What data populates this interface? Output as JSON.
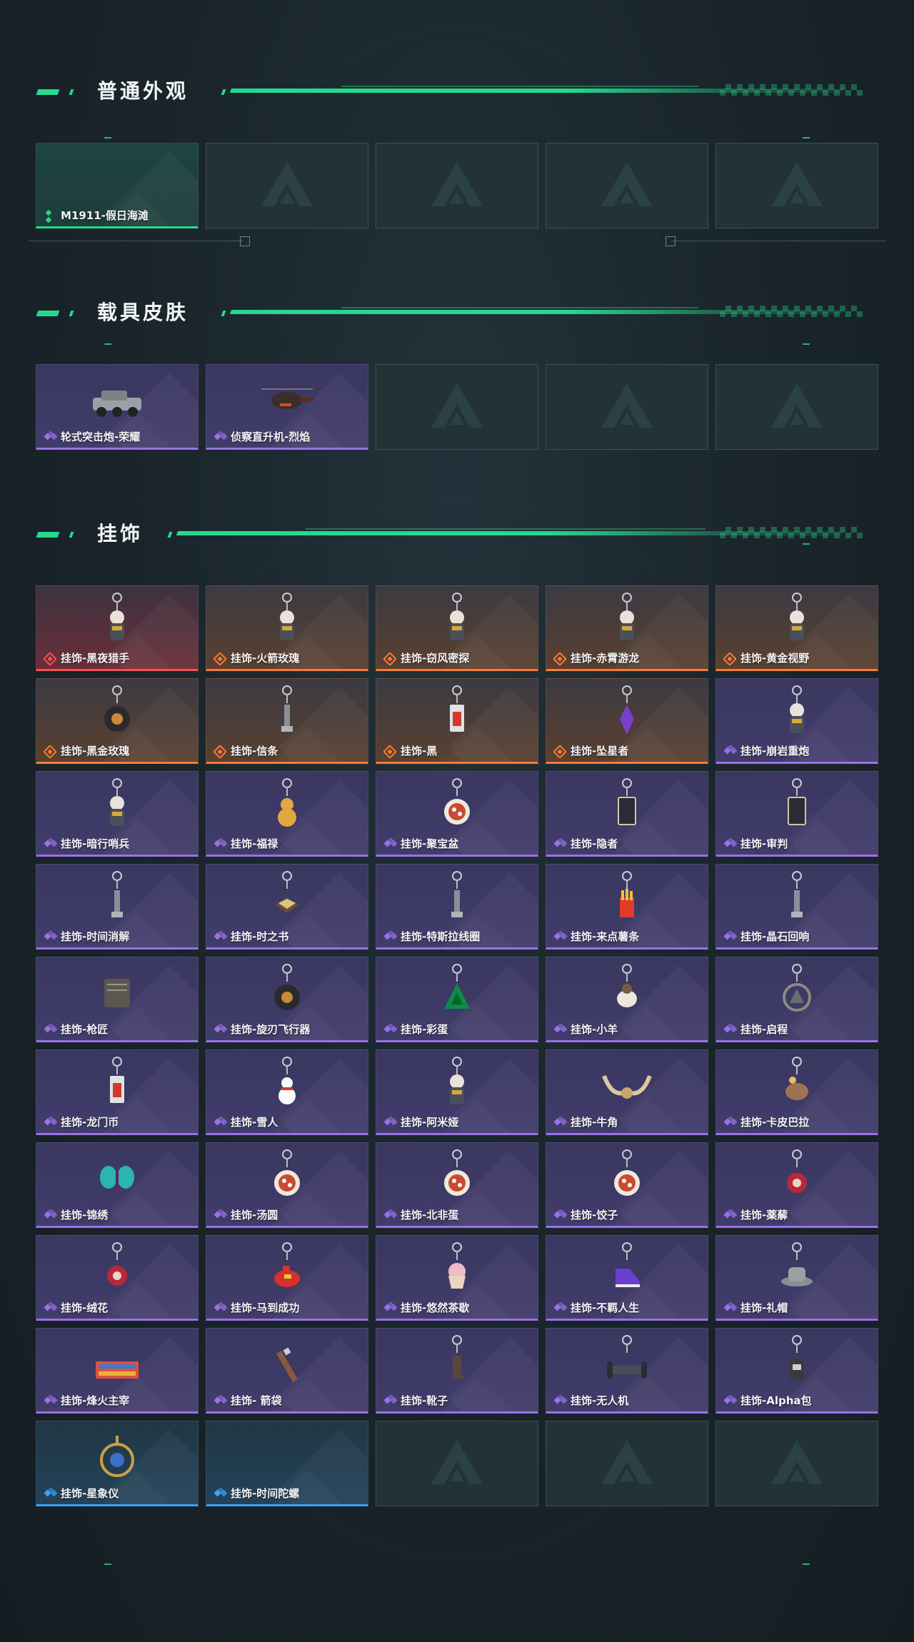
{
  "colors": {
    "accent": "#27d98d",
    "rarity_green": "#27d98d",
    "rarity_purple": "#9b71e8",
    "rarity_orange": "#ff7a33",
    "rarity_red": "#ff4d55",
    "rarity_blue": "#3aa3f5"
  },
  "sections": {
    "appearance": {
      "title": "普通外观",
      "items": [
        {
          "label": "M1911-假日海滩",
          "rarity": "green",
          "icon": "pistol-icon"
        },
        {
          "label": "",
          "rarity": "empty"
        },
        {
          "label": "",
          "rarity": "empty"
        },
        {
          "label": "",
          "rarity": "empty"
        },
        {
          "label": "",
          "rarity": "empty"
        }
      ]
    },
    "vehicle": {
      "title": "载具皮肤",
      "items": [
        {
          "label": "轮式突击炮-荣耀",
          "rarity": "purple",
          "icon": "armored-vehicle-icon"
        },
        {
          "label": "侦察直升机-烈焰",
          "rarity": "purple",
          "icon": "helicopter-icon"
        },
        {
          "label": "",
          "rarity": "empty"
        },
        {
          "label": "",
          "rarity": "empty"
        },
        {
          "label": "",
          "rarity": "empty"
        }
      ]
    },
    "charms": {
      "title": "挂饰",
      "items": [
        {
          "label": "挂饰-黑夜猎手",
          "rarity": "red",
          "icon": "figure-charm-icon"
        },
        {
          "label": "挂饰-火箭玫瑰",
          "rarity": "orange",
          "icon": "figure-charm-icon"
        },
        {
          "label": "挂饰-窃风密探",
          "rarity": "orange",
          "icon": "figure-charm-icon"
        },
        {
          "label": "挂饰-赤霄游龙",
          "rarity": "orange",
          "icon": "figure-charm-icon"
        },
        {
          "label": "挂饰-黄金视野",
          "rarity": "orange",
          "icon": "figure-charm-icon"
        },
        {
          "label": "挂饰-黑金玫瑰",
          "rarity": "orange",
          "icon": "orb-charm-icon"
        },
        {
          "label": "挂饰-信条",
          "rarity": "orange",
          "icon": "keyring-charm-icon"
        },
        {
          "label": "挂饰-黑",
          "rarity": "orange",
          "icon": "tag-charm-icon"
        },
        {
          "label": "挂饰-坠星者",
          "rarity": "orange",
          "icon": "crystal-charm-icon"
        },
        {
          "label": "挂饰-崩岩重炮",
          "rarity": "purple",
          "icon": "figure-charm-icon"
        },
        {
          "label": "挂饰-暗行哨兵",
          "rarity": "purple",
          "icon": "figure-charm-icon"
        },
        {
          "label": "挂饰-福禄",
          "rarity": "purple",
          "icon": "gourd-charm-icon"
        },
        {
          "label": "挂饰-聚宝盆",
          "rarity": "purple",
          "icon": "bowl-charm-icon"
        },
        {
          "label": "挂饰-隐者",
          "rarity": "purple",
          "icon": "card-charm-icon"
        },
        {
          "label": "挂饰-审判",
          "rarity": "purple",
          "icon": "card-charm-icon"
        },
        {
          "label": "挂饰-时间消解",
          "rarity": "purple",
          "icon": "keyring-charm-icon"
        },
        {
          "label": "挂饰-时之书",
          "rarity": "purple",
          "icon": "book-charm-icon"
        },
        {
          "label": "挂饰-特斯拉线圈",
          "rarity": "purple",
          "icon": "keyring-charm-icon"
        },
        {
          "label": "挂饰-来点薯条",
          "rarity": "purple",
          "icon": "fries-charm-icon"
        },
        {
          "label": "挂饰-晶石回响",
          "rarity": "purple",
          "icon": "keyring-charm-icon"
        },
        {
          "label": "挂饰-枪匠",
          "rarity": "purple",
          "icon": "tools-charm-icon"
        },
        {
          "label": "挂饰-旋刃飞行器",
          "rarity": "purple",
          "icon": "orb-charm-icon"
        },
        {
          "label": "挂饰-彩蛋",
          "rarity": "purple",
          "icon": "egg-charm-icon"
        },
        {
          "label": "挂饰-小羊",
          "rarity": "purple",
          "icon": "sheep-charm-icon"
        },
        {
          "label": "挂饰-启程",
          "rarity": "purple",
          "icon": "ring-charm-icon"
        },
        {
          "label": "挂饰-龙门币",
          "rarity": "purple",
          "icon": "tag-charm-icon"
        },
        {
          "label": "挂饰-雪人",
          "rarity": "purple",
          "icon": "snowman-charm-icon"
        },
        {
          "label": "挂饰-阿米娅",
          "rarity": "purple",
          "icon": "figure-charm-icon"
        },
        {
          "label": "挂饰-牛角",
          "rarity": "purple",
          "icon": "horns-charm-icon"
        },
        {
          "label": "挂饰-卡皮巴拉",
          "rarity": "purple",
          "icon": "capybara-charm-icon"
        },
        {
          "label": "挂饰-锦绣",
          "rarity": "purple",
          "icon": "butterfly-charm-icon"
        },
        {
          "label": "挂饰-汤圆",
          "rarity": "purple",
          "icon": "bowl-charm-icon"
        },
        {
          "label": "挂饰-北非蛋",
          "rarity": "purple",
          "icon": "bowl-charm-icon"
        },
        {
          "label": "挂饰-饺子",
          "rarity": "purple",
          "icon": "bowl-charm-icon"
        },
        {
          "label": "挂饰-薬薢",
          "rarity": "purple",
          "icon": "flower-charm-icon"
        },
        {
          "label": "挂饰-绒花",
          "rarity": "purple",
          "icon": "flower-charm-icon"
        },
        {
          "label": "挂饰-马到成功",
          "rarity": "purple",
          "icon": "horse-charm-icon"
        },
        {
          "label": "挂饰-悠然茶歇",
          "rarity": "purple",
          "icon": "cupcake-charm-icon"
        },
        {
          "label": "挂饰-不羁人生",
          "rarity": "purple",
          "icon": "shoe-charm-icon"
        },
        {
          "label": "挂饰-礼帽",
          "rarity": "purple",
          "icon": "hat-charm-icon"
        },
        {
          "label": "挂饰-烽火主宰",
          "rarity": "purple",
          "icon": "banner-charm-icon"
        },
        {
          "label": "挂饰- 箭袋",
          "rarity": "purple",
          "icon": "quiver-charm-icon"
        },
        {
          "label": "挂饰-靴子",
          "rarity": "purple",
          "icon": "boot-charm-icon"
        },
        {
          "label": "挂饰-无人机",
          "rarity": "purple",
          "icon": "drone-charm-icon"
        },
        {
          "label": "挂饰-Alpha包",
          "rarity": "purple",
          "icon": "bag-charm-icon"
        },
        {
          "label": "挂饰-星象仪",
          "rarity": "blue",
          "icon": "astrolabe-charm-icon"
        },
        {
          "label": "挂饰-时间陀螺",
          "rarity": "blue",
          "icon": "top-charm-icon"
        },
        {
          "label": "",
          "rarity": "empty"
        },
        {
          "label": "",
          "rarity": "empty"
        },
        {
          "label": "",
          "rarity": "empty"
        }
      ]
    }
  }
}
